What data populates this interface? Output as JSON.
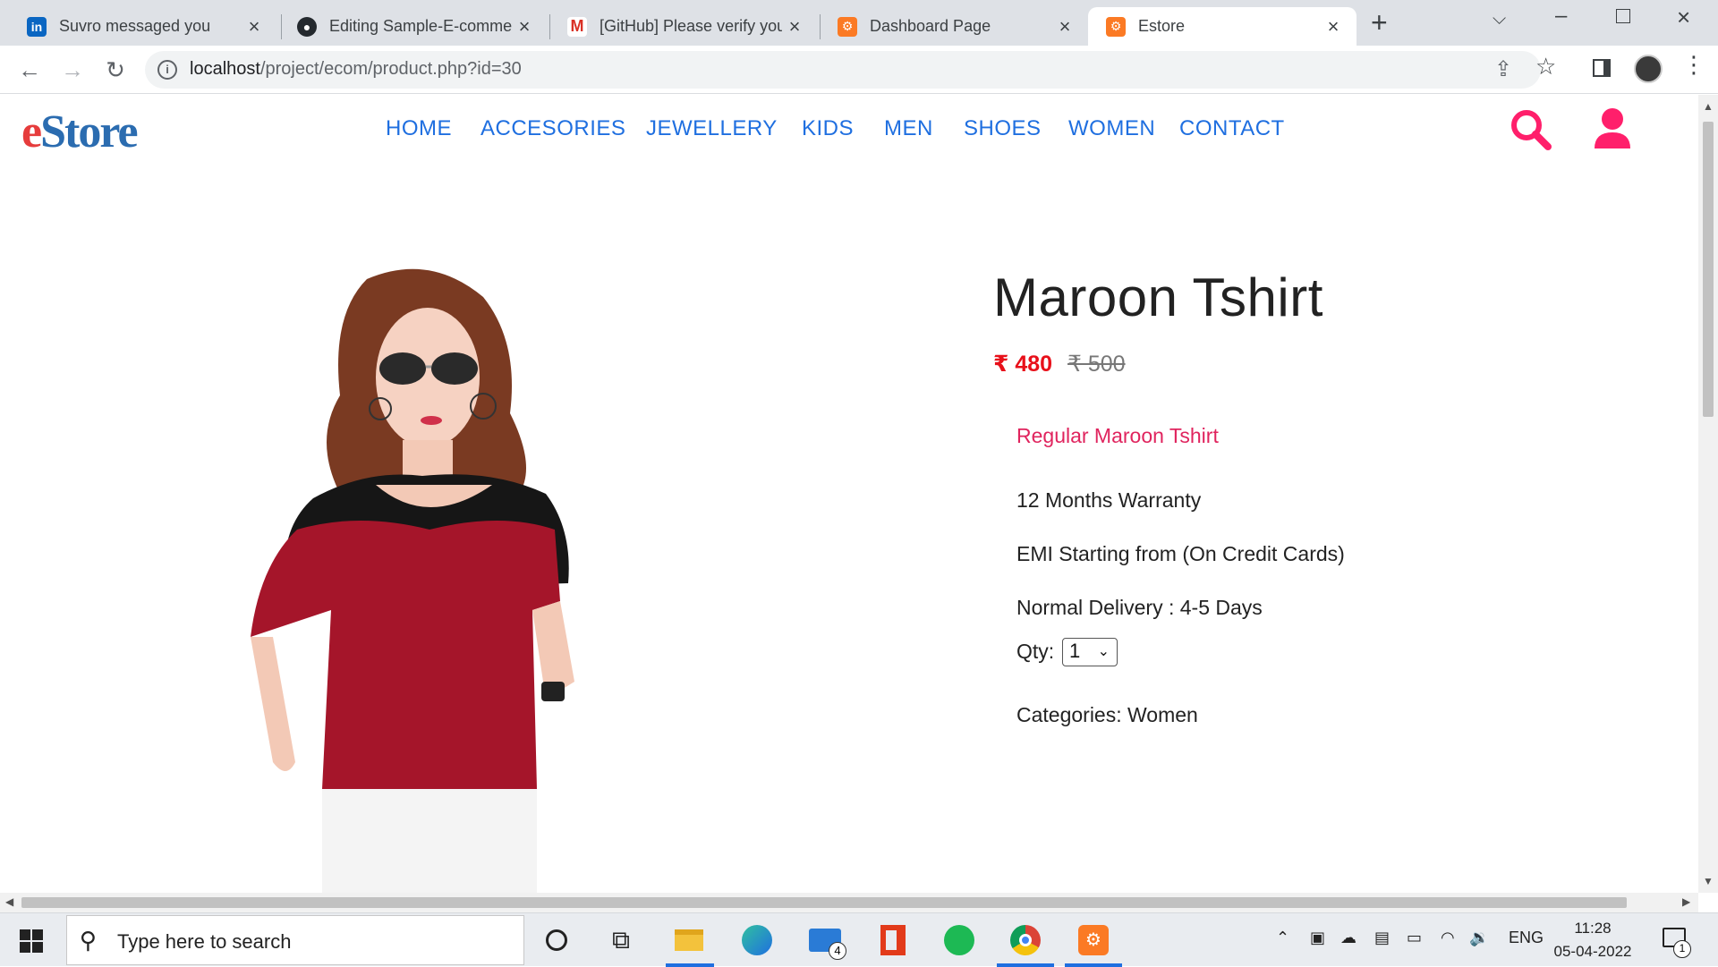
{
  "browser": {
    "tabs": [
      {
        "title": "Suvro messaged you",
        "icon": "linkedin-icon",
        "active": false
      },
      {
        "title": "Editing Sample-E-commer",
        "icon": "github-icon",
        "active": false
      },
      {
        "title": "[GitHub] Please verify you",
        "icon": "gmail-icon",
        "active": false
      },
      {
        "title": "Dashboard Page",
        "icon": "xampp-icon",
        "active": false
      },
      {
        "title": "Estore",
        "icon": "xampp-icon",
        "active": true
      }
    ],
    "url_host": "localhost",
    "url_path": "/project/ecom/product.php?id=30"
  },
  "site": {
    "logo_e": "e",
    "logo_rest": "Store",
    "nav": [
      "HOME",
      "ACCESORIES",
      "JEWELLERY",
      "KIDS",
      "MEN",
      "SHOES",
      "WOMEN",
      "CONTACT"
    ]
  },
  "product": {
    "title": "Maroon Tshirt",
    "price": "₹ 480",
    "mrp": "₹ 500",
    "description": "Regular Maroon Tshirt",
    "features": [
      "12 Months Warranty",
      "EMI Starting from (On Credit Cards)",
      "Normal Delivery : 4-5 Days"
    ],
    "qty_label": "Qty:",
    "qty_value": "1",
    "categories_label": "Categories:",
    "category": "Women"
  },
  "colors": {
    "accent_pink": "#ff1f6b",
    "nav_blue": "#1f6fe0",
    "price_red": "#e8101a"
  },
  "taskbar": {
    "search_placeholder": "Type here to search",
    "mail_badge": "4",
    "language": "ENG",
    "time": "11:28",
    "date": "05-04-2022",
    "notification_count": "1"
  }
}
